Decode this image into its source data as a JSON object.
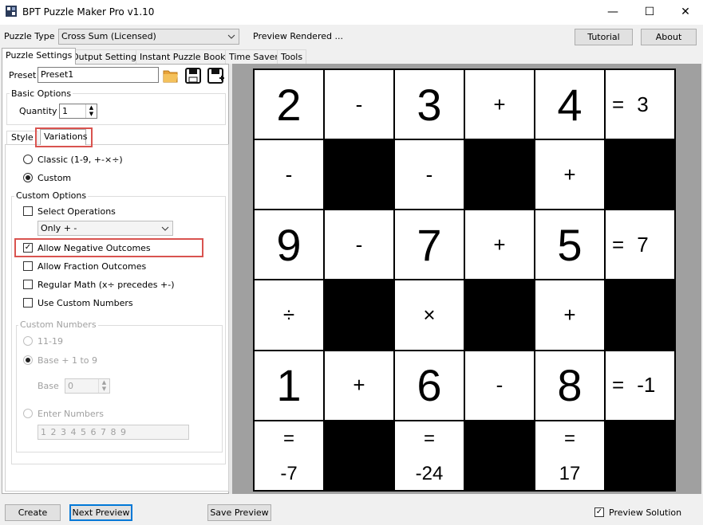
{
  "window": {
    "title": "BPT Puzzle Maker Pro v1.10",
    "minimize": "—",
    "maximize": "☐",
    "close": "✕"
  },
  "toolbar": {
    "puzzle_type_label": "Puzzle Type",
    "puzzle_type_value": "Cross Sum (Licensed)",
    "status": "Preview Rendered ...",
    "tutorial": "Tutorial",
    "about": "About"
  },
  "tabs": [
    "Puzzle Settings",
    "Output Settings",
    "Instant Puzzle Books",
    "Time Saver",
    "Tools"
  ],
  "preset": {
    "label": "Preset",
    "value": "Preset1"
  },
  "basic_options": {
    "title": "Basic Options",
    "quantity_label": "Quantity",
    "quantity_value": "1"
  },
  "subtabs": [
    "Style",
    "Variations"
  ],
  "variations": {
    "classic": "Classic (1-9, +-×÷)",
    "custom": "Custom",
    "custom_options_title": "Custom Options",
    "select_operations": "Select Operations",
    "operations_value": "Only + -",
    "allow_negative": "Allow Negative Outcomes",
    "allow_fraction": "Allow Fraction Outcomes",
    "regular_math": "Regular Math (x÷ precedes +-)",
    "use_custom_numbers": "Use Custom Numbers"
  },
  "custom_numbers": {
    "title": "Custom Numbers",
    "opt1": "11-19",
    "opt2": "Base + 1 to 9",
    "base_label": "Base",
    "base_value": "0",
    "enter_numbers": "Enter Numbers",
    "numbers_value": "1 2 3 4 5 6 7 8 9"
  },
  "puzzle": {
    "rows": [
      [
        "2",
        "-",
        "3",
        "+",
        "4",
        "= 3"
      ],
      [
        "-",
        "#",
        "-",
        "#",
        "+",
        "#"
      ],
      [
        "9",
        "-",
        "7",
        "+",
        "5",
        "= 7"
      ],
      [
        "÷",
        "#",
        "×",
        "#",
        "+",
        "#"
      ],
      [
        "1",
        "+",
        "6",
        "-",
        "8",
        "= -1"
      ],
      [
        "= -7",
        "#",
        "= -24",
        "#",
        "= 17",
        "#"
      ]
    ]
  },
  "bottom": {
    "create": "Create",
    "next_preview": "Next Preview",
    "save_preview": "Save Preview",
    "preview_solution": "Preview Solution"
  }
}
